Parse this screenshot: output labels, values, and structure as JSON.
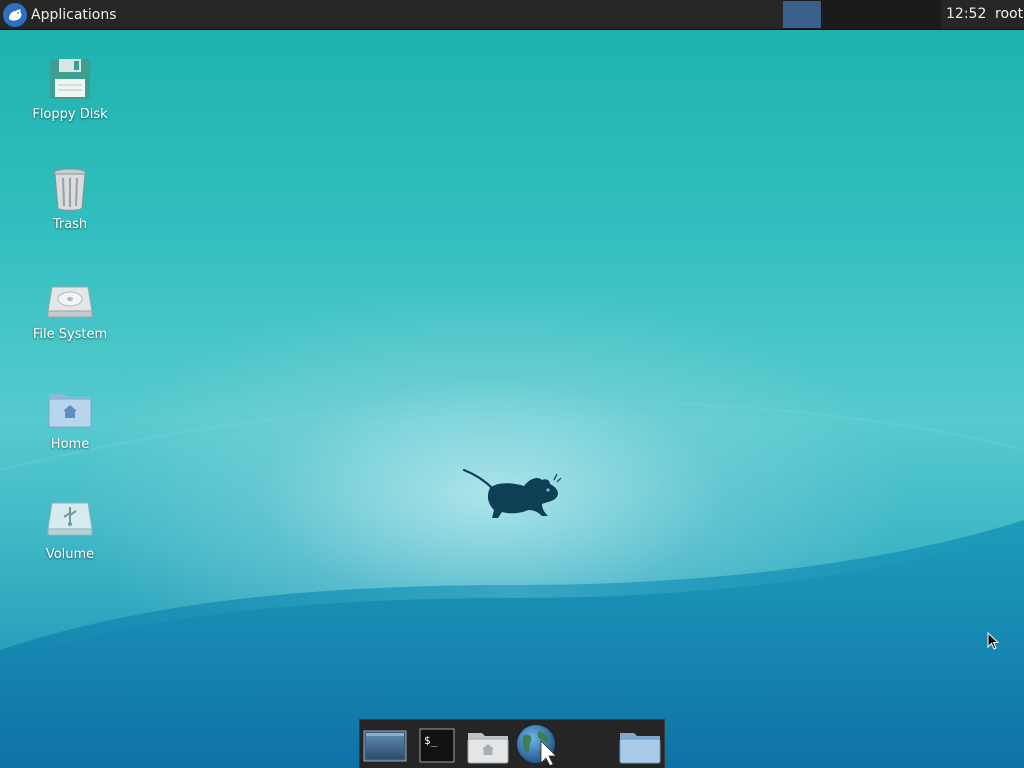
{
  "top_panel": {
    "applications_label": "Applications",
    "clock": "12:52",
    "user": "root"
  },
  "desktop_icons": [
    {
      "label": "Floppy Disk",
      "icon": "floppy-disk-icon"
    },
    {
      "label": "Trash",
      "icon": "trash-icon"
    },
    {
      "label": "File System",
      "icon": "hard-drive-icon"
    },
    {
      "label": "Home",
      "icon": "home-folder-icon"
    },
    {
      "label": "Volume",
      "icon": "usb-volume-icon"
    }
  ],
  "dock": {
    "items": [
      {
        "icon": "show-desktop-icon"
      },
      {
        "icon": "terminal-icon",
        "glyph": "$_"
      },
      {
        "icon": "file-manager-icon"
      },
      {
        "icon": "web-browser-icon"
      },
      {
        "icon": "folder-icon"
      }
    ]
  },
  "colors": {
    "panel_bg": "#262626",
    "workspace_active": "#3a5f8c",
    "desktop_teal": "#33bfbf",
    "desktop_deep": "#1686b0"
  }
}
